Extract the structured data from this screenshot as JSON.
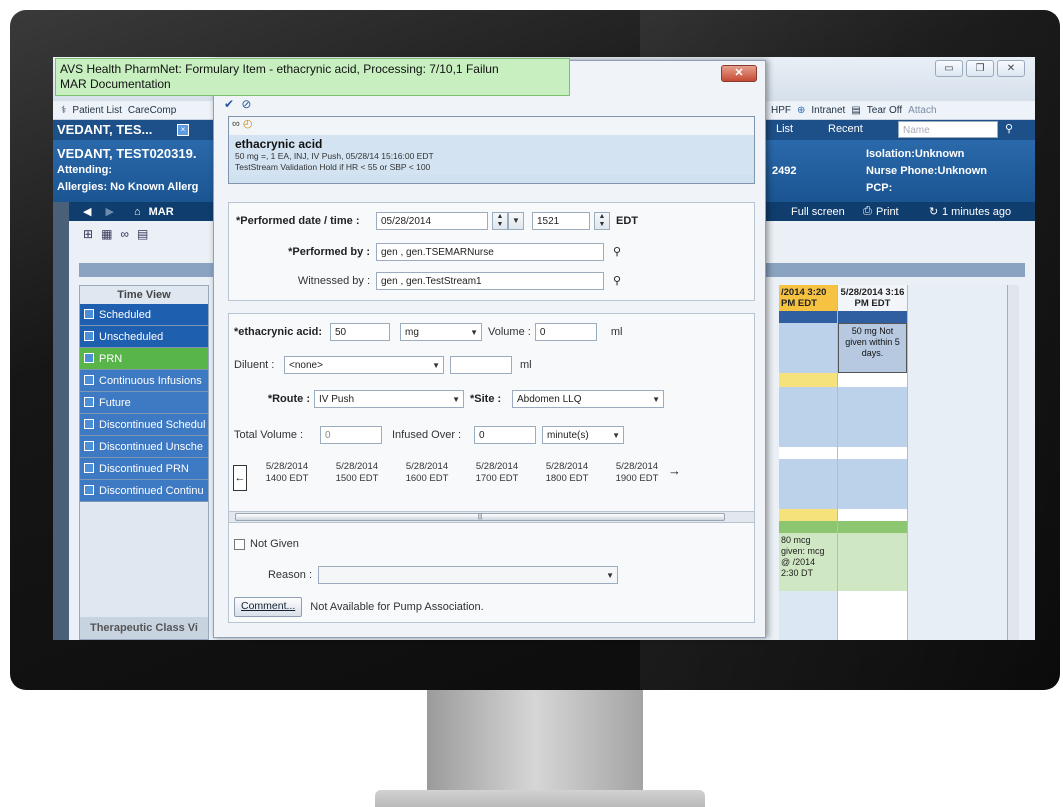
{
  "tooltip": {
    "line1": "AVS Health PharmNet: Formulary Item - ethacrynic acid, Processing: 7/10,1 Failun",
    "line2": "MAR Documentation"
  },
  "toolbar": {
    "patient_list": "Patient List",
    "carecompass": "CareComp",
    "hpf": "HPF",
    "intranet": "Intranet",
    "tear_off": "Tear Off",
    "attach": "Attach"
  },
  "patient": {
    "tab": "VEDANT, TES...",
    "name": "VEDANT, TEST020319.",
    "attending": "Attending:",
    "allergies": "Allergies: No Known Allerg",
    "id_frag": "2492",
    "isolation": "Isolation:Unknown",
    "nurse_phone": "Nurse Phone:Unknown",
    "pcp": "PCP:"
  },
  "nav": {
    "mar": "MAR",
    "list": "List",
    "recent": "Recent",
    "search_placeholder": "Name",
    "full_screen": "Full screen",
    "print": "Print",
    "refresh": "1 minutes ago"
  },
  "timeview": {
    "title": "Time View",
    "items": [
      "Scheduled",
      "Unscheduled",
      "PRN",
      "Continuous Infusions",
      "Future",
      "Discontinued Schedul",
      "Discontinued Unsche",
      "Discontinued PRN",
      "Discontinued Continu"
    ],
    "footer": "Therapeutic Class Vi"
  },
  "grid": {
    "col1_header": "/2014 3:20 PM EDT",
    "col2_header": "5/28/2014 3:16 PM EDT",
    "cell1": "50 mg Not given within 5 days.",
    "cell2": "80 mcg given: mcg @ /2014 2:30 DT"
  },
  "dialog": {
    "medication": {
      "name": "ethacrynic acid",
      "detail1": "50 mg =, 1 EA, INJ, IV Push, 05/28/14 15:16:00 EDT",
      "detail2": "TestStream Validation   Hold if HR < 55 or SBP < 100"
    },
    "performed_date_label": "*Performed date / time :",
    "performed_date": "05/28/2014",
    "performed_time": "1521",
    "timezone": "EDT",
    "performed_by_label": "*Performed by :",
    "performed_by": "gen , gen.TSEMARNurse",
    "witnessed_by_label": "Witnessed by :",
    "witnessed_by": "gen , gen.TestStream1",
    "dose_label": "*ethacrynic acid:",
    "dose": "50",
    "dose_unit": "mg",
    "volume_label": "Volume :",
    "volume": "0",
    "volume_unit": "ml",
    "diluent_label": "Diluent :",
    "diluent": "<none>",
    "diluent_unit": "ml",
    "route_label": "*Route :",
    "route": "IV Push",
    "site_label": "*Site :",
    "site": "Abdomen LLQ",
    "total_volume_label": "Total Volume :",
    "total_volume": "0",
    "infused_over_label": "Infused Over :",
    "infused_over": "0",
    "infused_unit": "minute(s)",
    "timeline": [
      {
        "date": "5/28/2014",
        "time": "1400 EDT"
      },
      {
        "date": "5/28/2014",
        "time": "1500 EDT"
      },
      {
        "date": "5/28/2014",
        "time": "1600 EDT"
      },
      {
        "date": "5/28/2014",
        "time": "1700 EDT"
      },
      {
        "date": "5/28/2014",
        "time": "1800 EDT"
      },
      {
        "date": "5/28/2014",
        "time": "1900 EDT"
      }
    ],
    "not_given_label": "Not Given",
    "reason_label": "Reason :",
    "comment_button": "Comment...",
    "pump_note": "Not Available for Pump Association."
  }
}
